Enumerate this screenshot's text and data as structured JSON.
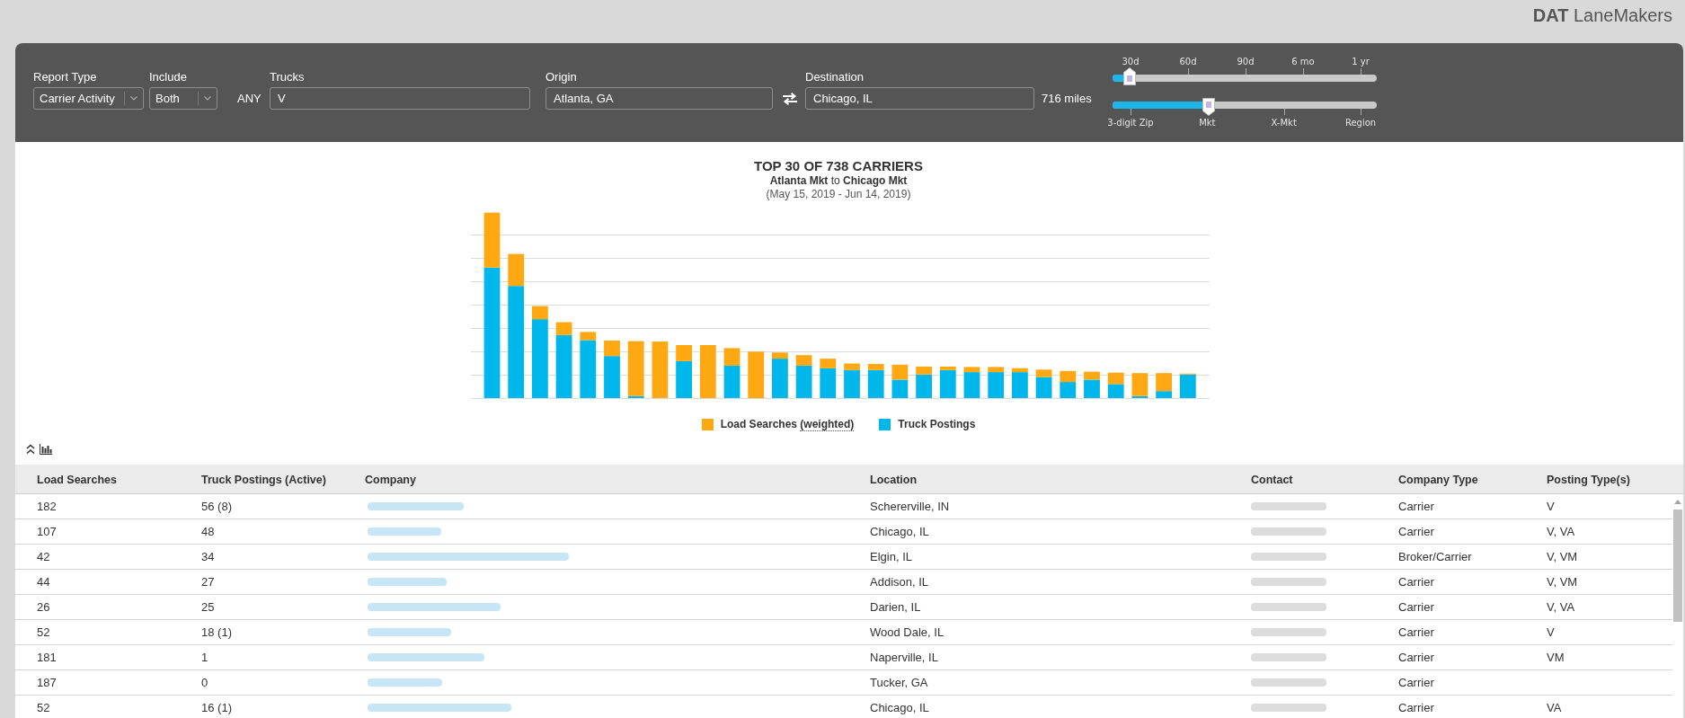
{
  "header": {
    "logo": "**DAT** LaneMakers"
  },
  "filters": {
    "report_type": {
      "label": "Report Type",
      "value": "Carrier Activity"
    },
    "include": {
      "label": "Include",
      "value": "Both"
    },
    "trucks": {
      "qualifier": "ANY",
      "label": "Trucks",
      "value": "V"
    },
    "origin": {
      "label": "Origin",
      "value": "Atlanta, GA"
    },
    "destination": {
      "label": "Destination",
      "value": "Chicago, IL"
    },
    "distance": "716 miles",
    "period_slider": {
      "ticks": [
        "30d",
        "60d",
        "90d",
        "6 mo",
        "1 yr"
      ],
      "level": 0.065
    },
    "scope_slider": {
      "ticks": [
        "3-digit Zip",
        "Mkt",
        "X-Mkt",
        "Region"
      ],
      "level": 0.364
    }
  },
  "chart": {
    "title": "TOP 30 OF 738 CARRIERS",
    "subtitle": "**Atlanta Mkt** to **Chicago Mkt**",
    "date_range": "(May 15, 2019 - Jun 14, 2019)",
    "legend": [
      {
        "label": "Load Searches",
        "note": "(weighted)",
        "color": "#ffa812"
      },
      {
        "label": "Truck Postings",
        "color": "#00b7eb"
      }
    ]
  },
  "table": {
    "columns": [
      {
        "label": "Load Searches",
        "kind": "text"
      },
      {
        "label": "Truck Postings (Active)",
        "kind": "text"
      },
      {
        "label": "Company",
        "kind": "redactedlink"
      },
      {
        "label": "Location",
        "kind": "text"
      },
      {
        "label": "Contact",
        "kind": "redacted"
      },
      {
        "label": "Company Type",
        "kind": "text"
      },
      {
        "label": "Posting Type(s)",
        "kind": "text"
      }
    ],
    "rows": [
      [
        "182",
        "56 (8)",
        "",
        "Schererville, IN",
        "",
        "Carrier",
        "V"
      ],
      [
        "107",
        "48",
        "",
        "Chicago, IL",
        "",
        "Carrier",
        "V, VA"
      ],
      [
        "42",
        "34",
        "",
        "Elgin, IL",
        "",
        "Broker/Carrier",
        "V, VM"
      ],
      [
        "44",
        "27",
        "",
        "Addison, IL",
        "",
        "Carrier",
        "V, VM"
      ],
      [
        "26",
        "25",
        "",
        "Darien, IL",
        "",
        "Carrier",
        "V, VA"
      ],
      [
        "52",
        "18 (1)",
        "",
        "Wood Dale, IL",
        "",
        "Carrier",
        "V"
      ],
      [
        "181",
        "1",
        "",
        "Naperville, IL",
        "",
        "Carrier",
        "VM"
      ],
      [
        "187",
        "0",
        "",
        "Tucker, GA",
        "",
        "Carrier"
      ],
      [
        "52",
        "16 (1)",
        "",
        "Chicago, IL",
        "",
        "Carrier",
        "VA"
      ]
    ]
  }
}
